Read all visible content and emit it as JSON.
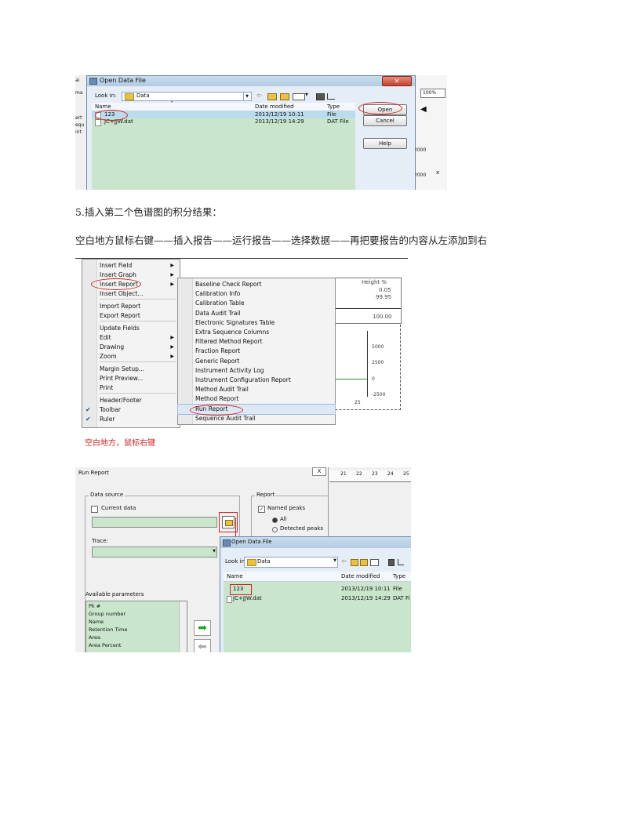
{
  "step_heading": "5.插入第二个色谱图的积分结果：",
  "instruction": "空白地方鼠标右键——插入报告——运行报告——选择数据——再把要报告的内容从左添加到右",
  "shot1": {
    "dialog_title": "Open Data File",
    "look_in_label": "Look in:",
    "look_in_value": "Data",
    "columns": {
      "name": "Name",
      "date": "Date modified",
      "type": "Type"
    },
    "files": [
      {
        "name": "123",
        "date": "2013/12/19 10:11",
        "type": "File"
      },
      {
        "name": "JC+JJW.dat",
        "date": "2013/12/19 14:29",
        "type": "DAT File"
      }
    ],
    "buttons": {
      "open": "Open",
      "cancel": "Cancel",
      "help": "Help"
    },
    "zoom": "100%",
    "side_left": [
      "ai",
      "ma",
      "ert",
      "equ",
      "int"
    ],
    "side_right": [
      "2000",
      "2000"
    ]
  },
  "shot2": {
    "context_menu": [
      {
        "label": "Insert Field",
        "sub": true
      },
      {
        "label": "Insert Graph",
        "sub": true
      },
      {
        "label": "Insert Report",
        "sub": true
      },
      {
        "label": "Insert Object...",
        "sub": false
      },
      {
        "label": "Import Report",
        "sub": false
      },
      {
        "label": "Export Report",
        "sub": false
      },
      {
        "label": "Update Fields",
        "sub": false
      },
      {
        "label": "Edit",
        "sub": true
      },
      {
        "label": "Drawing",
        "sub": true
      },
      {
        "label": "Zoom",
        "sub": true
      },
      {
        "label": "Margin Setup...",
        "sub": false
      },
      {
        "label": "Print Preview...",
        "sub": false
      },
      {
        "label": "Print",
        "sub": false
      },
      {
        "label": "Header/Footer",
        "sub": false
      },
      {
        "label": "Toolbar",
        "sub": false,
        "checked": true
      },
      {
        "label": "Ruler",
        "sub": false,
        "checked": true
      }
    ],
    "submenu": [
      "Baseline Check Report",
      "Calibration Info",
      "Calibration Table",
      "Data Audit Trail",
      "Electronic Signatures Table",
      "Extra Sequence Columns",
      "Filtered Method Report",
      "Fraction Report",
      "Generic Report",
      "Instrument Activity Log",
      "Instrument Configuration Report",
      "Method Audit Trail",
      "Method Report",
      "Run Report",
      "Sequence Audit Trail"
    ],
    "height_header": "Height %",
    "height_values": [
      "0.05",
      "99.95",
      "100.00"
    ],
    "axis_ticks": [
      "5000",
      "2500",
      "0",
      "-2500",
      "25"
    ],
    "caption": "空白地方，鼠标右键"
  },
  "shot3": {
    "window_title": "Run Report",
    "data_source_label": "Data source",
    "current_data_label": "Current data",
    "trace_label": "Trace:",
    "available_params_label": "Available parameters",
    "params": [
      "Pk #",
      "Group number",
      "Name",
      "Retention Time",
      "Area",
      "Area Percent"
    ],
    "report_label": "Report",
    "named_peaks_label": "Named peaks",
    "all_label": "All",
    "detected_label": "Detected peaks",
    "ruler_numbers": [
      "21",
      "22",
      "23",
      "24",
      "25"
    ],
    "dialog_title": "Open Data File",
    "look_in_label": "Look in:",
    "look_in_value": "Data",
    "columns": {
      "name": "Name",
      "date": "Date modified",
      "type": "Type"
    },
    "files": [
      {
        "name": "123",
        "date": "2013/12/19 10:11",
        "type": "File"
      },
      {
        "name": "JC+JJW.dat",
        "date": "2013/12/19 14:29",
        "type": "DAT Fi"
      }
    ]
  }
}
